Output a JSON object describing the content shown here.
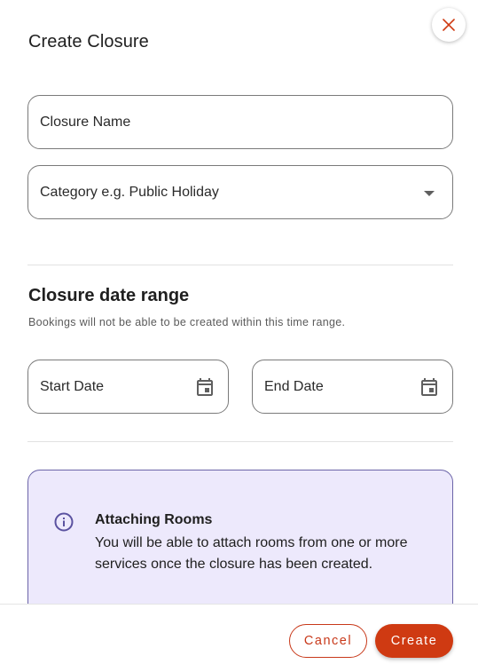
{
  "dialog": {
    "title": "Create Closure",
    "close_icon": "close-icon"
  },
  "form": {
    "closure_name_label": "Closure Name",
    "category_label": "Category e.g. Public Holiday",
    "category_icon": "chevron-down-icon"
  },
  "date_range": {
    "title": "Closure date range",
    "subtitle": "Bookings will not be able to be created within this time range.",
    "start_label": "Start Date",
    "end_label": "End Date",
    "calendar_icon": "calendar-icon"
  },
  "info": {
    "icon": "info-icon",
    "heading": "Attaching Rooms",
    "body": "You will be able to attach rooms from one or more services once the closure has been created."
  },
  "footer": {
    "cancel_label": "Cancel",
    "create_label": "Create"
  },
  "colors": {
    "accent": "#cf3a12",
    "info_bg": "#ede9fc",
    "info_border": "#6b64a8",
    "info_icon": "#5b52a0"
  }
}
